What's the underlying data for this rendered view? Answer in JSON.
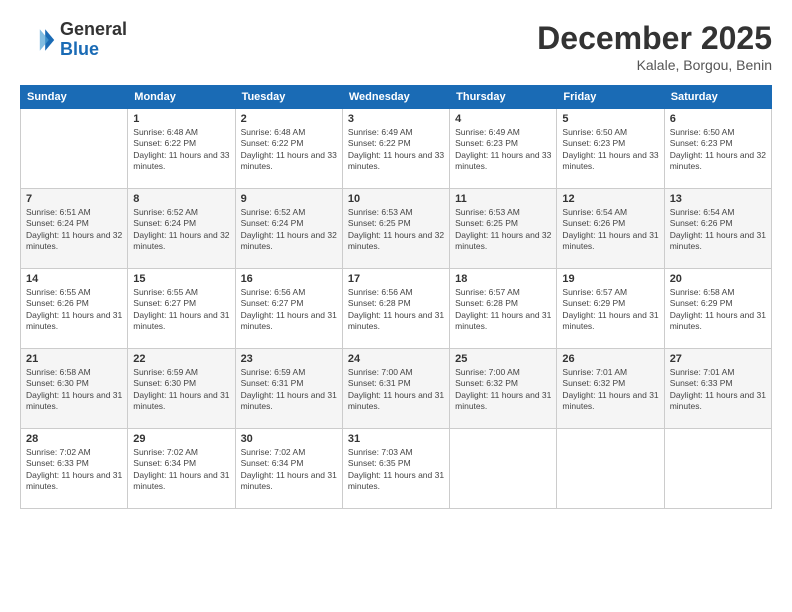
{
  "header": {
    "logo_general": "General",
    "logo_blue": "Blue",
    "month_title": "December 2025",
    "location": "Kalale, Borgou, Benin"
  },
  "days_of_week": [
    "Sunday",
    "Monday",
    "Tuesday",
    "Wednesday",
    "Thursday",
    "Friday",
    "Saturday"
  ],
  "weeks": [
    [
      {
        "day": "",
        "sunrise": "",
        "sunset": "",
        "daylight": ""
      },
      {
        "day": "1",
        "sunrise": "Sunrise: 6:48 AM",
        "sunset": "Sunset: 6:22 PM",
        "daylight": "Daylight: 11 hours and 33 minutes."
      },
      {
        "day": "2",
        "sunrise": "Sunrise: 6:48 AM",
        "sunset": "Sunset: 6:22 PM",
        "daylight": "Daylight: 11 hours and 33 minutes."
      },
      {
        "day": "3",
        "sunrise": "Sunrise: 6:49 AM",
        "sunset": "Sunset: 6:22 PM",
        "daylight": "Daylight: 11 hours and 33 minutes."
      },
      {
        "day": "4",
        "sunrise": "Sunrise: 6:49 AM",
        "sunset": "Sunset: 6:23 PM",
        "daylight": "Daylight: 11 hours and 33 minutes."
      },
      {
        "day": "5",
        "sunrise": "Sunrise: 6:50 AM",
        "sunset": "Sunset: 6:23 PM",
        "daylight": "Daylight: 11 hours and 33 minutes."
      },
      {
        "day": "6",
        "sunrise": "Sunrise: 6:50 AM",
        "sunset": "Sunset: 6:23 PM",
        "daylight": "Daylight: 11 hours and 32 minutes."
      }
    ],
    [
      {
        "day": "7",
        "sunrise": "Sunrise: 6:51 AM",
        "sunset": "Sunset: 6:24 PM",
        "daylight": "Daylight: 11 hours and 32 minutes."
      },
      {
        "day": "8",
        "sunrise": "Sunrise: 6:52 AM",
        "sunset": "Sunset: 6:24 PM",
        "daylight": "Daylight: 11 hours and 32 minutes."
      },
      {
        "day": "9",
        "sunrise": "Sunrise: 6:52 AM",
        "sunset": "Sunset: 6:24 PM",
        "daylight": "Daylight: 11 hours and 32 minutes."
      },
      {
        "day": "10",
        "sunrise": "Sunrise: 6:53 AM",
        "sunset": "Sunset: 6:25 PM",
        "daylight": "Daylight: 11 hours and 32 minutes."
      },
      {
        "day": "11",
        "sunrise": "Sunrise: 6:53 AM",
        "sunset": "Sunset: 6:25 PM",
        "daylight": "Daylight: 11 hours and 32 minutes."
      },
      {
        "day": "12",
        "sunrise": "Sunrise: 6:54 AM",
        "sunset": "Sunset: 6:26 PM",
        "daylight": "Daylight: 11 hours and 31 minutes."
      },
      {
        "day": "13",
        "sunrise": "Sunrise: 6:54 AM",
        "sunset": "Sunset: 6:26 PM",
        "daylight": "Daylight: 11 hours and 31 minutes."
      }
    ],
    [
      {
        "day": "14",
        "sunrise": "Sunrise: 6:55 AM",
        "sunset": "Sunset: 6:26 PM",
        "daylight": "Daylight: 11 hours and 31 minutes."
      },
      {
        "day": "15",
        "sunrise": "Sunrise: 6:55 AM",
        "sunset": "Sunset: 6:27 PM",
        "daylight": "Daylight: 11 hours and 31 minutes."
      },
      {
        "day": "16",
        "sunrise": "Sunrise: 6:56 AM",
        "sunset": "Sunset: 6:27 PM",
        "daylight": "Daylight: 11 hours and 31 minutes."
      },
      {
        "day": "17",
        "sunrise": "Sunrise: 6:56 AM",
        "sunset": "Sunset: 6:28 PM",
        "daylight": "Daylight: 11 hours and 31 minutes."
      },
      {
        "day": "18",
        "sunrise": "Sunrise: 6:57 AM",
        "sunset": "Sunset: 6:28 PM",
        "daylight": "Daylight: 11 hours and 31 minutes."
      },
      {
        "day": "19",
        "sunrise": "Sunrise: 6:57 AM",
        "sunset": "Sunset: 6:29 PM",
        "daylight": "Daylight: 11 hours and 31 minutes."
      },
      {
        "day": "20",
        "sunrise": "Sunrise: 6:58 AM",
        "sunset": "Sunset: 6:29 PM",
        "daylight": "Daylight: 11 hours and 31 minutes."
      }
    ],
    [
      {
        "day": "21",
        "sunrise": "Sunrise: 6:58 AM",
        "sunset": "Sunset: 6:30 PM",
        "daylight": "Daylight: 11 hours and 31 minutes."
      },
      {
        "day": "22",
        "sunrise": "Sunrise: 6:59 AM",
        "sunset": "Sunset: 6:30 PM",
        "daylight": "Daylight: 11 hours and 31 minutes."
      },
      {
        "day": "23",
        "sunrise": "Sunrise: 6:59 AM",
        "sunset": "Sunset: 6:31 PM",
        "daylight": "Daylight: 11 hours and 31 minutes."
      },
      {
        "day": "24",
        "sunrise": "Sunrise: 7:00 AM",
        "sunset": "Sunset: 6:31 PM",
        "daylight": "Daylight: 11 hours and 31 minutes."
      },
      {
        "day": "25",
        "sunrise": "Sunrise: 7:00 AM",
        "sunset": "Sunset: 6:32 PM",
        "daylight": "Daylight: 11 hours and 31 minutes."
      },
      {
        "day": "26",
        "sunrise": "Sunrise: 7:01 AM",
        "sunset": "Sunset: 6:32 PM",
        "daylight": "Daylight: 11 hours and 31 minutes."
      },
      {
        "day": "27",
        "sunrise": "Sunrise: 7:01 AM",
        "sunset": "Sunset: 6:33 PM",
        "daylight": "Daylight: 11 hours and 31 minutes."
      }
    ],
    [
      {
        "day": "28",
        "sunrise": "Sunrise: 7:02 AM",
        "sunset": "Sunset: 6:33 PM",
        "daylight": "Daylight: 11 hours and 31 minutes."
      },
      {
        "day": "29",
        "sunrise": "Sunrise: 7:02 AM",
        "sunset": "Sunset: 6:34 PM",
        "daylight": "Daylight: 11 hours and 31 minutes."
      },
      {
        "day": "30",
        "sunrise": "Sunrise: 7:02 AM",
        "sunset": "Sunset: 6:34 PM",
        "daylight": "Daylight: 11 hours and 31 minutes."
      },
      {
        "day": "31",
        "sunrise": "Sunrise: 7:03 AM",
        "sunset": "Sunset: 6:35 PM",
        "daylight": "Daylight: 11 hours and 31 minutes."
      },
      {
        "day": "",
        "sunrise": "",
        "sunset": "",
        "daylight": ""
      },
      {
        "day": "",
        "sunrise": "",
        "sunset": "",
        "daylight": ""
      },
      {
        "day": "",
        "sunrise": "",
        "sunset": "",
        "daylight": ""
      }
    ]
  ]
}
